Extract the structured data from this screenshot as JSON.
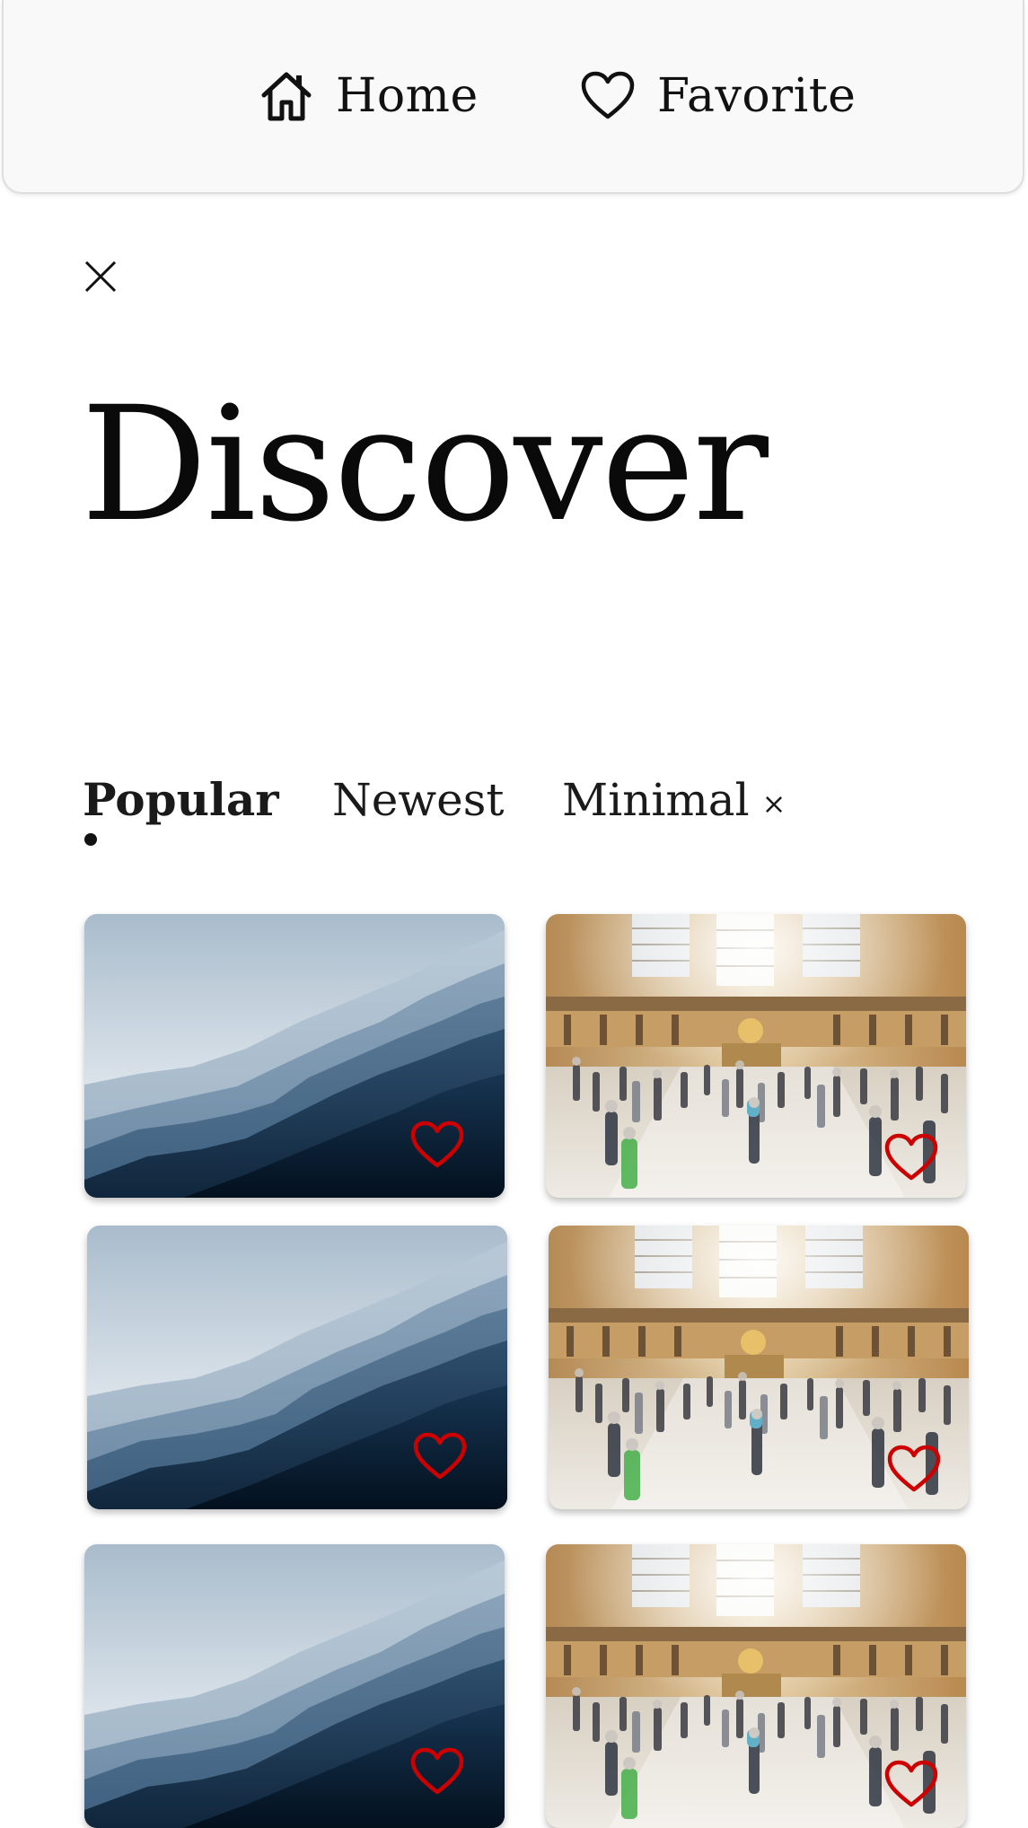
{
  "nav": {
    "items": [
      {
        "label": "Home",
        "icon": "home-icon"
      },
      {
        "label": "Favorite",
        "icon": "heart-icon"
      }
    ]
  },
  "close_icon": "close-icon",
  "title": "Discover",
  "tabs": [
    {
      "label": "Popular",
      "active": true
    },
    {
      "label": "Newest",
      "active": false
    },
    {
      "label": "Minimal",
      "active": false,
      "removable": true,
      "remove_glyph": "×"
    }
  ],
  "gallery": {
    "rows": [
      [
        {
          "subject": "mountain ridges",
          "favorite": true
        },
        {
          "subject": "station concourse",
          "favorite": true
        }
      ],
      [
        {
          "subject": "mountain ridges",
          "favorite": true
        },
        {
          "subject": "station concourse",
          "favorite": true
        }
      ],
      [
        {
          "subject": "mountain ridges",
          "favorite": true
        },
        {
          "subject": "station concourse",
          "favorite": true
        }
      ]
    ]
  },
  "colors": {
    "heart": "#cc0000",
    "nav_background": "#f9f9f9",
    "text": "#111111"
  }
}
